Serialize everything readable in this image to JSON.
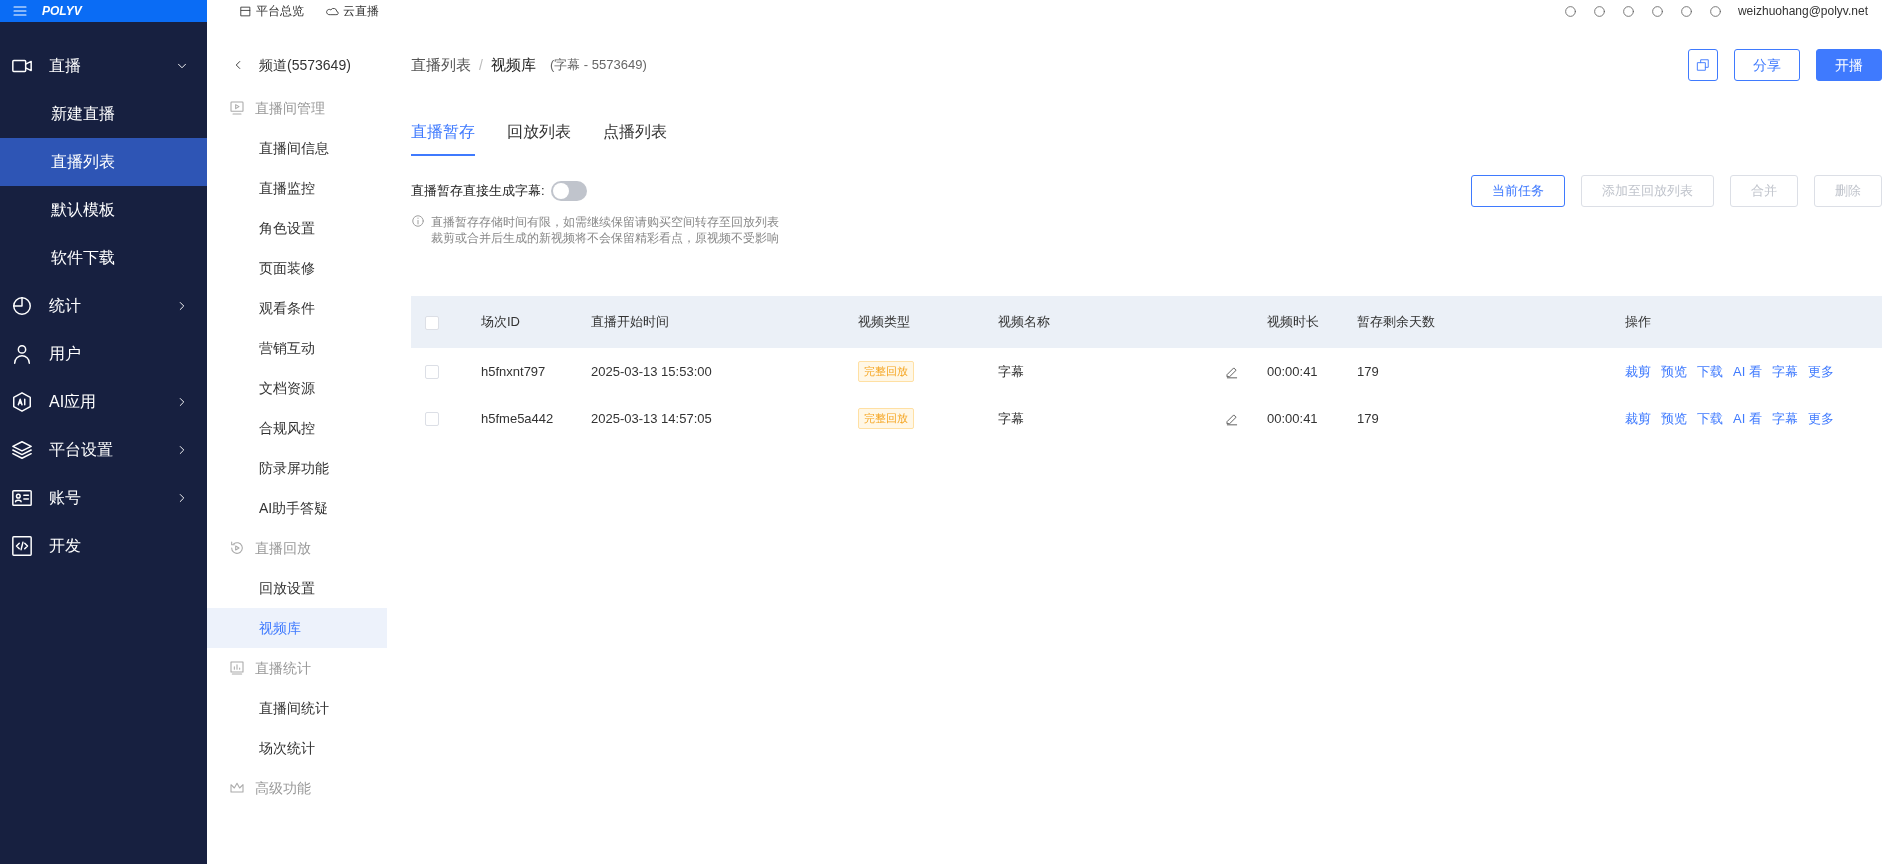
{
  "top_bar": {
    "logo": "POLYV",
    "nav": [
      {
        "label": "平台总览"
      },
      {
        "label": "云直播"
      }
    ],
    "user": "weizhuohang@polyv.net"
  },
  "sidebar": {
    "items": [
      {
        "label": "直播",
        "expanded": true,
        "children": [
          {
            "label": "新建直播",
            "selected": false
          },
          {
            "label": "直播列表",
            "selected": true
          },
          {
            "label": "默认模板",
            "selected": false
          },
          {
            "label": "软件下载",
            "selected": false
          }
        ]
      },
      {
        "label": "统计",
        "expanded": false
      },
      {
        "label": "用户"
      },
      {
        "label": "AI应用",
        "expanded": false
      },
      {
        "label": "平台设置",
        "expanded": false
      },
      {
        "label": "账号",
        "expanded": false
      },
      {
        "label": "开发"
      }
    ]
  },
  "subnav": {
    "back": "频道(5573649)",
    "groups": [
      {
        "title": "直播间管理",
        "items": [
          {
            "label": "直播间信息",
            "selected": false
          },
          {
            "label": "直播监控",
            "selected": false
          },
          {
            "label": "角色设置",
            "selected": false
          },
          {
            "label": "页面装修",
            "selected": false
          },
          {
            "label": "观看条件",
            "selected": false
          },
          {
            "label": "营销互动",
            "selected": false
          },
          {
            "label": "文档资源",
            "selected": false
          },
          {
            "label": "合规风控",
            "selected": false
          },
          {
            "label": "防录屏功能",
            "selected": false
          },
          {
            "label": "AI助手答疑",
            "selected": false
          }
        ]
      },
      {
        "title": "直播回放",
        "items": [
          {
            "label": "回放设置",
            "selected": false
          },
          {
            "label": "视频库",
            "selected": true
          }
        ]
      },
      {
        "title": "直播统计",
        "items": [
          {
            "label": "直播间统计",
            "selected": false
          },
          {
            "label": "场次统计",
            "selected": false
          }
        ]
      },
      {
        "title": "高级功能"
      }
    ]
  },
  "breadcrumb": {
    "items": [
      "直播列表",
      "视频库"
    ],
    "separator": "/",
    "note": "(字幕 - 5573649)"
  },
  "header_buttons": [
    {
      "kind": "icon"
    },
    {
      "kind": "outline",
      "label": "分享"
    },
    {
      "kind": "primary",
      "label": "开播"
    }
  ],
  "tabs": [
    {
      "label": "直播暂存",
      "selected": true
    },
    {
      "label": "回放列表",
      "selected": false
    },
    {
      "label": "点播列表",
      "selected": false
    }
  ],
  "toggle": {
    "label": "直播暂存直接生成字幕:",
    "on": false
  },
  "actions": [
    {
      "label": "当前任务",
      "disabled": false
    },
    {
      "label": "添加至回放列表",
      "disabled": true
    },
    {
      "label": "合并",
      "disabled": true
    },
    {
      "label": "删除",
      "disabled": true
    }
  ],
  "notice": [
    "直播暂存存储时间有限，如需继续保留请购买空间转存至回放列表",
    "裁剪或合并后生成的新视频将不会保留精彩看点，原视频不受影响"
  ],
  "table": {
    "columns": [
      "场次ID",
      "直播开始时间",
      "视频类型",
      "视频名称",
      "视频时长",
      "暂存剩余天数",
      "操作"
    ],
    "all_checked": false,
    "rows": [
      {
        "checked": false,
        "id": "h5fnxnt797",
        "start": "2025-03-13 15:53:00",
        "type": "完整回放",
        "name": "字幕",
        "duration": "00:00:41",
        "days": "179",
        "ops": [
          "裁剪",
          "预览",
          "下载",
          "AI 看",
          "字幕",
          "更多"
        ]
      },
      {
        "checked": false,
        "id": "h5fme5a442",
        "start": "2025-03-13 14:57:05",
        "type": "完整回放",
        "name": "字幕",
        "duration": "00:00:41",
        "days": "179",
        "ops": [
          "裁剪",
          "预览",
          "下载",
          "AI 看",
          "字幕",
          "更多"
        ]
      }
    ]
  }
}
